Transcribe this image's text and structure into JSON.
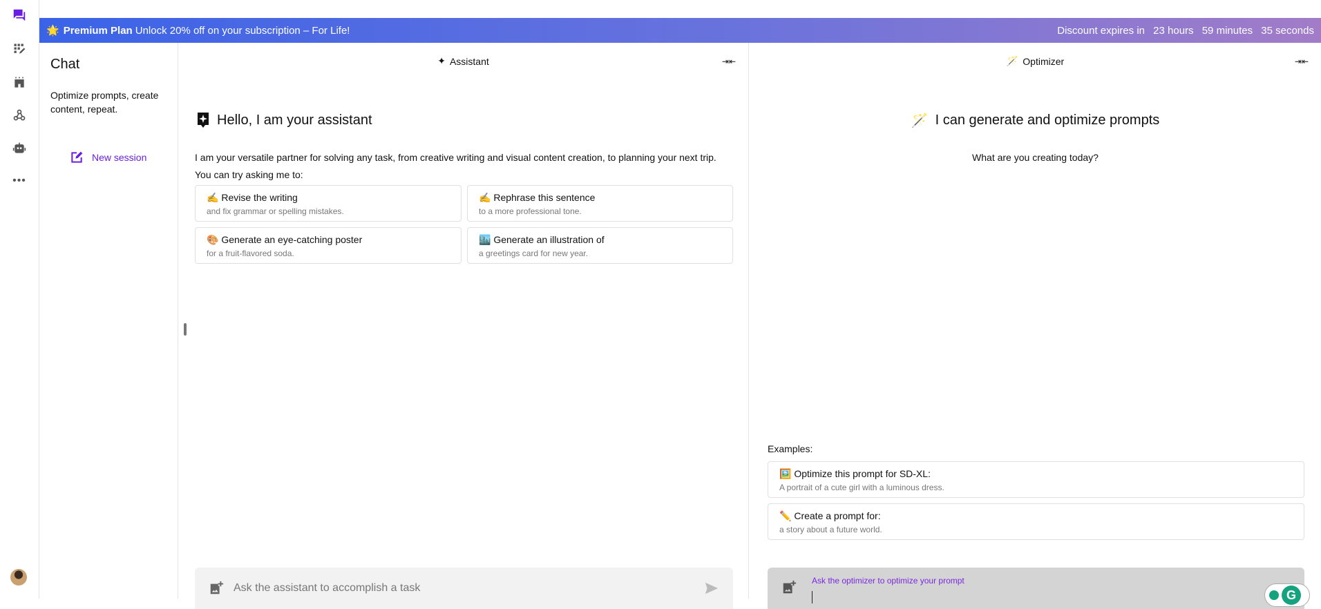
{
  "banner": {
    "plan": "Premium Plan",
    "offer": "Unlock 20% off on your subscription – For Life!",
    "expires_label": "Discount expires in",
    "hours": "23 hours",
    "minutes": "59 minutes",
    "seconds": "35 seconds"
  },
  "sidebar": {
    "title": "Chat",
    "description": "Optimize prompts, create content, repeat.",
    "new_session": "New session"
  },
  "assistant": {
    "header": "Assistant",
    "heading": "Hello, I am your assistant",
    "intro": "I am your versatile partner for solving any task, from creative writing and visual content creation, to planning your next trip.",
    "try": "You can try asking me to:",
    "suggestions": [
      {
        "emoji": "✍️",
        "title": "Revise the writing",
        "subtitle": "and fix grammar or spelling mistakes."
      },
      {
        "emoji": "✍️",
        "title": "Rephrase this sentence",
        "subtitle": "to a more professional tone."
      },
      {
        "emoji": "🎨",
        "title": "Generate an eye-catching poster",
        "subtitle": "for a fruit-flavored soda."
      },
      {
        "emoji": "🏙️",
        "title": "Generate an illustration of",
        "subtitle": "a greetings card for new year."
      }
    ],
    "input_placeholder": "Ask the assistant to accomplish a task"
  },
  "optimizer": {
    "header": "Optimizer",
    "heading": "I can generate and optimize prompts",
    "subheading": "What are you creating today?",
    "examples_label": "Examples:",
    "examples": [
      {
        "emoji": "🖼️",
        "title": "Optimize this prompt for SD-XL:",
        "subtitle": "A portrait of a cute girl with a luminous dress."
      },
      {
        "emoji": "✏️",
        "title": "Create a prompt for:",
        "subtitle": "a story about a future world."
      }
    ],
    "input_placeholder": "Ask the optimizer to optimize your prompt"
  },
  "colors": {
    "accent": "#6a1de0",
    "banner_start": "#3a63e8",
    "banner_end": "#a27cc8"
  }
}
